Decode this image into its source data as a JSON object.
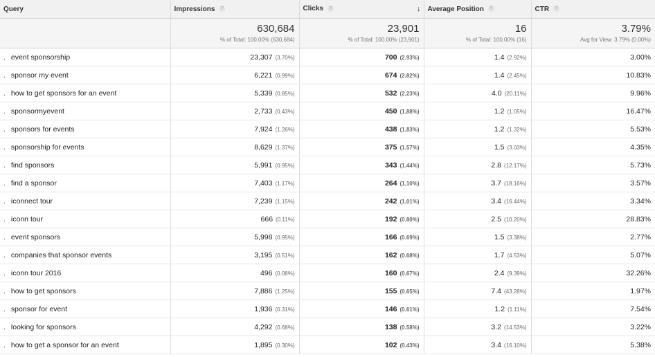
{
  "columns": {
    "query": "Query",
    "impressions": "Impressions",
    "clicks": "Clicks",
    "avg_position": "Average Position",
    "ctr": "CTR"
  },
  "icons": {
    "help": "help-icon",
    "sort": "sort-descending-arrow-icon"
  },
  "totals": {
    "impressions": "630,684",
    "impressions_sub": "% of Total: 100.00% (630,684)",
    "clicks": "23,901",
    "clicks_sub": "% of Total: 100.00% (23,901)",
    "avg_position": "16",
    "avg_position_sub": "% of Total: 100.00% (16)",
    "ctr": "3.79%",
    "ctr_sub": "Avg for View: 3.79% (0.00%)"
  },
  "rows": [
    {
      "query": "event sponsorship",
      "impressions": "23,307",
      "impressions_pct": "(3.70%)",
      "clicks": "700",
      "clicks_pct": "(2.93%)",
      "position": "1.4",
      "position_pct": "(2.92%)",
      "ctr": "3.00%"
    },
    {
      "query": "sponsor my event",
      "impressions": "6,221",
      "impressions_pct": "(0.99%)",
      "clicks": "674",
      "clicks_pct": "(2.82%)",
      "position": "1.4",
      "position_pct": "(2.45%)",
      "ctr": "10.83%"
    },
    {
      "query": "how to get sponsors for an event",
      "impressions": "5,339",
      "impressions_pct": "(0.85%)",
      "clicks": "532",
      "clicks_pct": "(2.23%)",
      "position": "4.0",
      "position_pct": "(20.11%)",
      "ctr": "9.96%"
    },
    {
      "query": "sponsormyevent",
      "impressions": "2,733",
      "impressions_pct": "(0.43%)",
      "clicks": "450",
      "clicks_pct": "(1.88%)",
      "position": "1.2",
      "position_pct": "(1.05%)",
      "ctr": "16.47%"
    },
    {
      "query": "sponsors for events",
      "impressions": "7,924",
      "impressions_pct": "(1.26%)",
      "clicks": "438",
      "clicks_pct": "(1.83%)",
      "position": "1.2",
      "position_pct": "(1.32%)",
      "ctr": "5.53%"
    },
    {
      "query": "sponsorship for events",
      "impressions": "8,629",
      "impressions_pct": "(1.37%)",
      "clicks": "375",
      "clicks_pct": "(1.57%)",
      "position": "1.5",
      "position_pct": "(3.03%)",
      "ctr": "4.35%"
    },
    {
      "query": "find sponsors",
      "impressions": "5,991",
      "impressions_pct": "(0.95%)",
      "clicks": "343",
      "clicks_pct": "(1.44%)",
      "position": "2.8",
      "position_pct": "(12.17%)",
      "ctr": "5.73%"
    },
    {
      "query": "find a sponsor",
      "impressions": "7,403",
      "impressions_pct": "(1.17%)",
      "clicks": "264",
      "clicks_pct": "(1.10%)",
      "position": "3.7",
      "position_pct": "(18.16%)",
      "ctr": "3.57%"
    },
    {
      "query": "iconnect tour",
      "impressions": "7,239",
      "impressions_pct": "(1.15%)",
      "clicks": "242",
      "clicks_pct": "(1.01%)",
      "position": "3.4",
      "position_pct": "(16.44%)",
      "ctr": "3.34%"
    },
    {
      "query": "iconn tour",
      "impressions": "666",
      "impressions_pct": "(0.11%)",
      "clicks": "192",
      "clicks_pct": "(0.80%)",
      "position": "2.5",
      "position_pct": "(10.20%)",
      "ctr": "28.83%"
    },
    {
      "query": "event sponsors",
      "impressions": "5,998",
      "impressions_pct": "(0.95%)",
      "clicks": "166",
      "clicks_pct": "(0.69%)",
      "position": "1.5",
      "position_pct": "(3.38%)",
      "ctr": "2.77%"
    },
    {
      "query": "companies that sponsor events",
      "impressions": "3,195",
      "impressions_pct": "(0.51%)",
      "clicks": "162",
      "clicks_pct": "(0.68%)",
      "position": "1.7",
      "position_pct": "(4.53%)",
      "ctr": "5.07%"
    },
    {
      "query": "iconn tour 2016",
      "impressions": "496",
      "impressions_pct": "(0.08%)",
      "clicks": "160",
      "clicks_pct": "(0.67%)",
      "position": "2.4",
      "position_pct": "(9.39%)",
      "ctr": "32.26%"
    },
    {
      "query": "how to get sponsors",
      "impressions": "7,886",
      "impressions_pct": "(1.25%)",
      "clicks": "155",
      "clicks_pct": "(0.65%)",
      "position": "7.4",
      "position_pct": "(43.28%)",
      "ctr": "1.97%"
    },
    {
      "query": "sponsor for event",
      "impressions": "1,936",
      "impressions_pct": "(0.31%)",
      "clicks": "146",
      "clicks_pct": "(0.61%)",
      "position": "1.2",
      "position_pct": "(1.11%)",
      "ctr": "7.54%"
    },
    {
      "query": "looking for sponsors",
      "impressions": "4,292",
      "impressions_pct": "(0.68%)",
      "clicks": "138",
      "clicks_pct": "(0.58%)",
      "position": "3.2",
      "position_pct": "(14.53%)",
      "ctr": "3.22%"
    },
    {
      "query": "how to get a sponsor for an event",
      "impressions": "1,895",
      "impressions_pct": "(0.30%)",
      "clicks": "102",
      "clicks_pct": "(0.43%)",
      "position": "3.4",
      "position_pct": "(16.10%)",
      "ctr": "5.38%"
    }
  ]
}
